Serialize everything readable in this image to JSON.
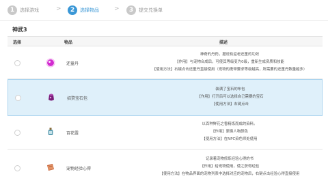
{
  "steps": [
    {
      "number": "1",
      "label": "选择游戏"
    },
    {
      "number": "2",
      "label": "选择物品"
    },
    {
      "number": "3",
      "label": "提交兑换单"
    }
  ],
  "step_separator": ">",
  "section_title": "神武3",
  "table": {
    "headers": {
      "select": "选择",
      "item": "物品",
      "description": "描述"
    },
    "rows": [
      {
        "name": "还童丹",
        "icon": "pink-orb-icon",
        "selected": false,
        "desc": [
          "神奇的丹药，据说有返老还童的功效",
          "【作用】与宠物合成后，可使其等级变为0级，重新生成资质和技能",
          "【使用方法】右键点击还童丹直接使用（宠物的携带要求等级越高，所需要的还童丹数量越多）"
        ]
      },
      {
        "name": "招赘宝石包",
        "icon": "purple-pouch-icon",
        "selected": true,
        "desc": [
          "装满了宝石的布包",
          "【作用】打开后可以选择自己需要的宝石",
          "【使用方法】右键点击"
        ]
      },
      {
        "name": "百花露",
        "icon": "perfume-bottle-icon",
        "selected": false,
        "desc": [
          "以百种鲜花之香精炼而成的染料。",
          "【作用】更换人物颜色",
          "【使用方法】在NPC染色师处使用"
        ]
      },
      {
        "name": "宠物经验心得",
        "icon": "book-icon",
        "selected": false,
        "desc": [
          "记录着宠物修炼经验心得的书",
          "【作用】给宠物使用，使之获得经验",
          "【使用方法】在物品界面的宠物列表中选择对应的宠物后，右键点击经验心得直接使用"
        ]
      }
    ]
  },
  "colors": {
    "accent": "#3a97d6",
    "selected_row": "#dff0fa"
  }
}
